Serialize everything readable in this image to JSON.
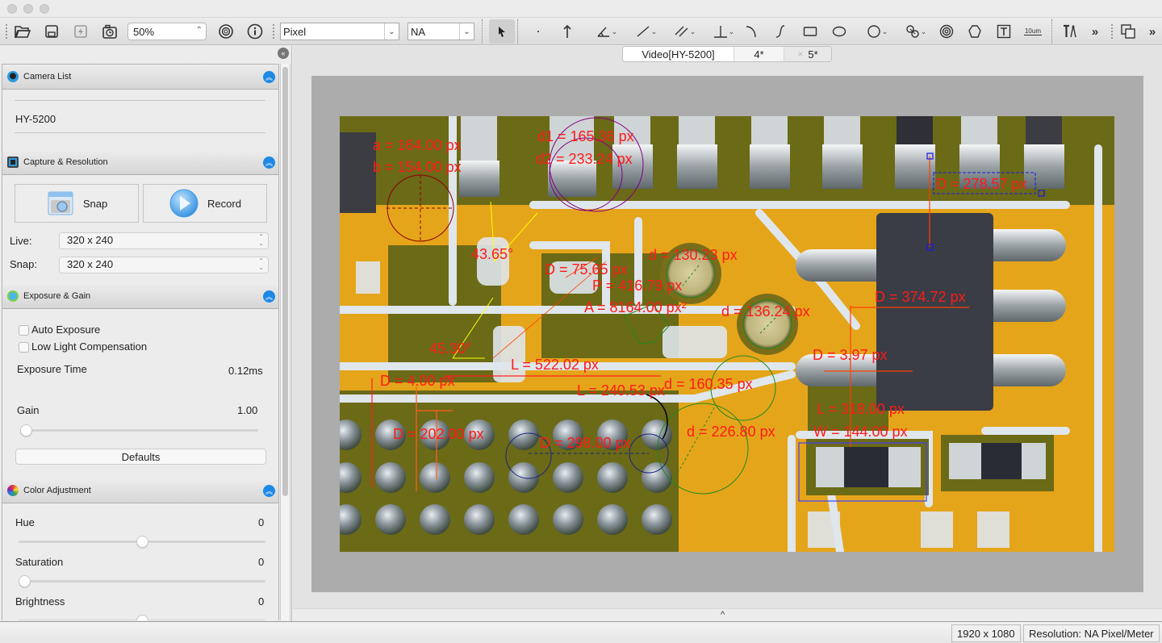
{
  "window": {
    "traffic_lights": [
      "close",
      "minimize",
      "zoom"
    ]
  },
  "toolbar": {
    "zoom_value": "50%",
    "unit_value": "Pixel",
    "magnification_value": "NA",
    "more_label": "»",
    "more_label_2": "»",
    "scale_bar_label": "10um"
  },
  "left_panel": {
    "collapse_label": "«",
    "sections": {
      "camera_list": {
        "title": "Camera List",
        "camera": "HY-5200"
      },
      "capture": {
        "title": "Capture & Resolution",
        "snap_button": "Snap",
        "record_button": "Record",
        "live_label": "Live:",
        "live_value": "320 x 240",
        "snap_label": "Snap:",
        "snap_value": "320 x 240"
      },
      "exposure": {
        "title": "Exposure & Gain",
        "auto_exposure": {
          "label": "Auto Exposure",
          "checked": false
        },
        "low_light": {
          "label": "Low Light Compensation",
          "checked": false
        },
        "exposure_time_label": "Exposure Time",
        "exposure_time_value": "0.12ms",
        "gain_label": "Gain",
        "gain_value": "1.00",
        "gain_slider_fraction": 0.0,
        "defaults_button": "Defaults"
      },
      "color": {
        "title": "Color Adjustment",
        "hue_label": "Hue",
        "hue_value": "0",
        "hue_slider_fraction": 0.5,
        "saturation_label": "Saturation",
        "saturation_value": "0",
        "saturation_slider_fraction": 0.0,
        "brightness_label": "Brightness",
        "brightness_value": "0",
        "brightness_slider_fraction": 0.5
      }
    }
  },
  "main": {
    "tabs": [
      {
        "label": "Video[HY-5200]",
        "active": true
      },
      {
        "label": "4*",
        "active": false
      },
      {
        "label": "5*",
        "active": false,
        "close": "×"
      }
    ],
    "expand_label": "^",
    "measurements": [
      {
        "id": "a",
        "text": "a = 164.00 px"
      },
      {
        "id": "b",
        "text": "b = 154.00 px"
      },
      {
        "id": "d1",
        "text": "d1 = 165.36 px"
      },
      {
        "id": "d2",
        "text": "d2 = 233.24 px"
      },
      {
        "id": "angle1",
        "text": "43.65°"
      },
      {
        "id": "D75",
        "text": "D = 75.65 px"
      },
      {
        "id": "d130",
        "text": "d = 130.23 px"
      },
      {
        "id": "P",
        "text": "P = 416.79 px"
      },
      {
        "id": "A",
        "text": "A = 8164.00 px²"
      },
      {
        "id": "d136",
        "text": "d = 136.24 px"
      },
      {
        "id": "D278",
        "text": "D = 278.57 px"
      },
      {
        "id": "D374",
        "text": "D = 374.72 px"
      },
      {
        "id": "angle2",
        "text": "45.30°"
      },
      {
        "id": "L522",
        "text": "L = 522.02 px"
      },
      {
        "id": "D4",
        "text": "D = 4.00 px"
      },
      {
        "id": "d160",
        "text": "d = 160.35 px"
      },
      {
        "id": "L240",
        "text": "L = 240.53 px"
      },
      {
        "id": "D397",
        "text": "D = 3.97 px"
      },
      {
        "id": "D202",
        "text": "D = 202.00 px"
      },
      {
        "id": "D298",
        "text": "D = 298.00 px"
      },
      {
        "id": "d226",
        "text": "d = 226.80 px"
      },
      {
        "id": "L318",
        "text": "L = 318.00 px"
      },
      {
        "id": "W144",
        "text": "W = 144.00 px"
      }
    ]
  },
  "status": {
    "image_size": "1920 x 1080",
    "resolution": "Resolution: NA Pixel/Meter"
  },
  "colors": {
    "accent_blue": "#1e88e5",
    "measurement_red": "#ff1a1a",
    "pcb_yellow": "#e9a91c"
  }
}
